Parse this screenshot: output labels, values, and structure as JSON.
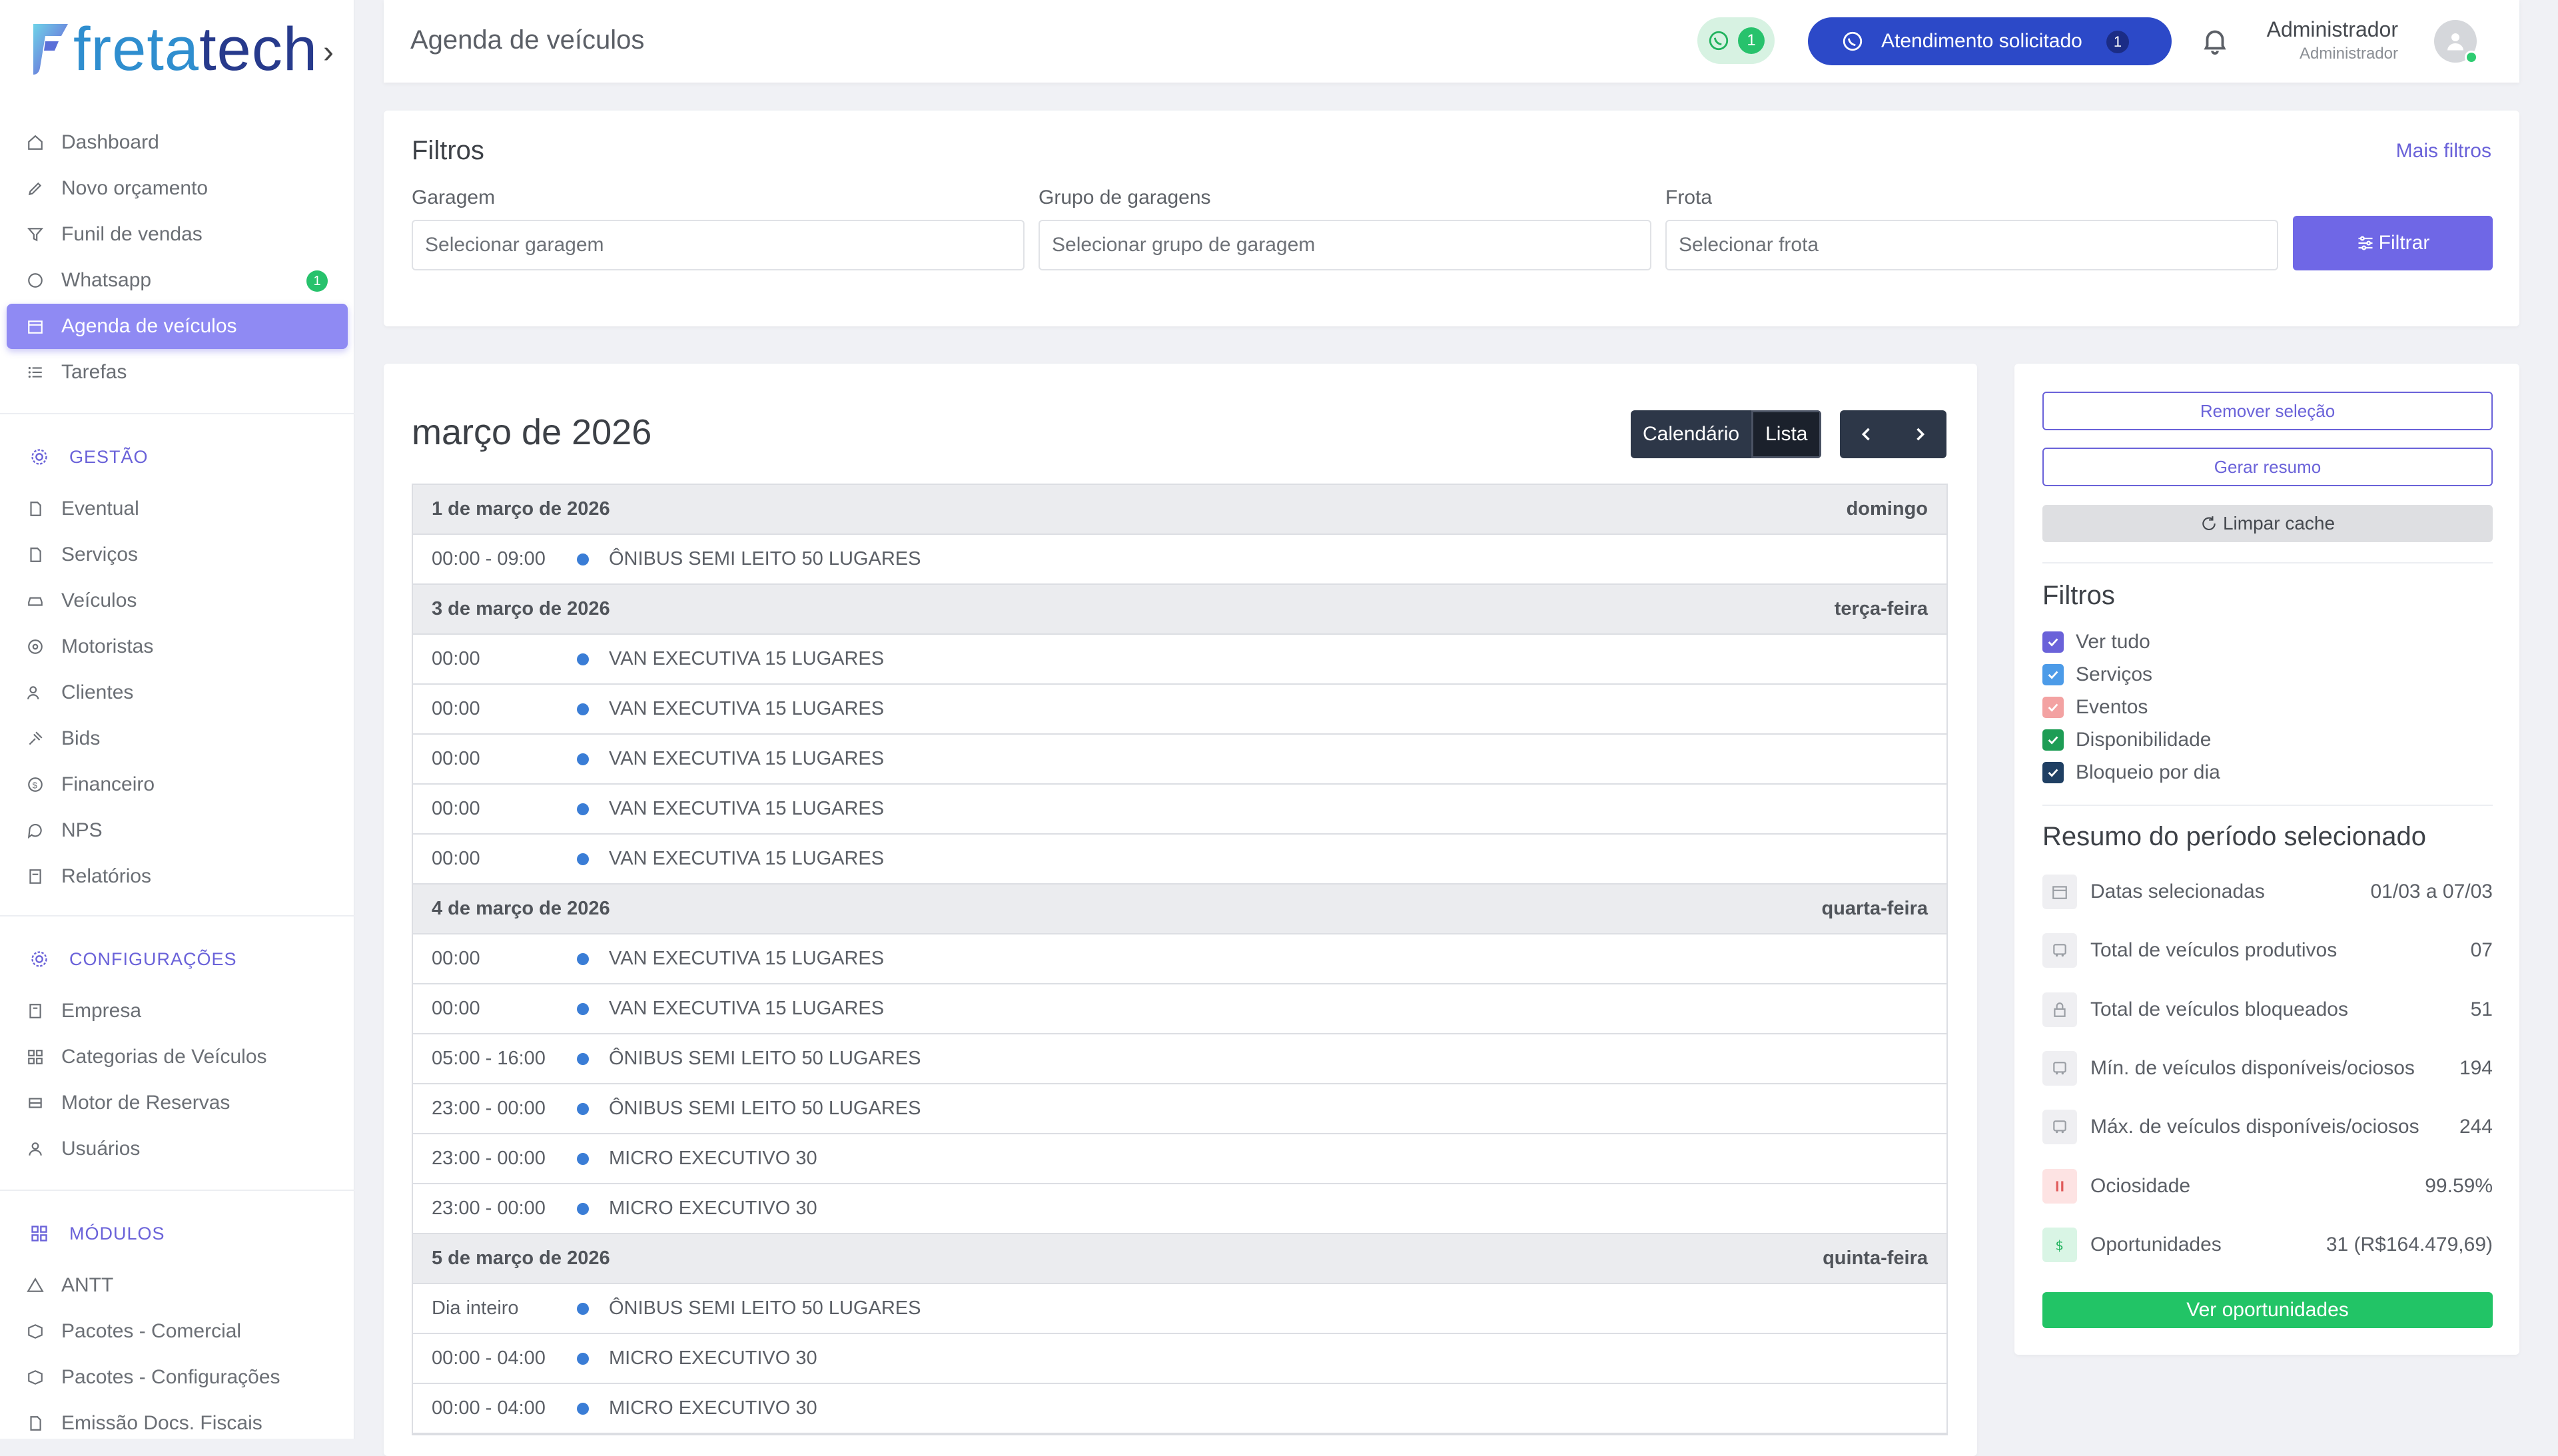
{
  "brand": {
    "fr": "freta",
    "tc": "tech"
  },
  "sidebar": {
    "main_items": [
      {
        "label": "Dashboard"
      },
      {
        "label": "Novo orçamento"
      },
      {
        "label": "Funil de vendas"
      },
      {
        "label": "Whatsapp",
        "badge": "1"
      },
      {
        "label": "Agenda de veículos",
        "active": true
      },
      {
        "label": "Tarefas"
      }
    ],
    "gestao": {
      "heading": "GESTÃO",
      "items": [
        {
          "label": "Eventual"
        },
        {
          "label": "Serviços"
        },
        {
          "label": "Veículos"
        },
        {
          "label": "Motoristas"
        },
        {
          "label": "Clientes"
        },
        {
          "label": "Bids"
        },
        {
          "label": "Financeiro"
        },
        {
          "label": "NPS"
        },
        {
          "label": "Relatórios"
        }
      ]
    },
    "config": {
      "heading": "CONFIGURAÇÕES",
      "items": [
        {
          "label": "Empresa"
        },
        {
          "label": "Categorias de Veículos"
        },
        {
          "label": "Motor de Reservas"
        },
        {
          "label": "Usuários"
        }
      ]
    },
    "modulos": {
      "heading": "MÓDULOS",
      "items": [
        {
          "label": "ANTT"
        },
        {
          "label": "Pacotes - Comercial"
        },
        {
          "label": "Pacotes - Configurações"
        },
        {
          "label": "Emissão Docs. Fiscais"
        }
      ]
    }
  },
  "header": {
    "title": "Agenda de veículos",
    "whatsapp_count": "1",
    "attend_label": "Atendimento solicitado",
    "attend_count": "1",
    "user_name": "Administrador",
    "user_role": "Administrador"
  },
  "filters": {
    "title": "Filtros",
    "more": "Mais filtros",
    "garagem_label": "Garagem",
    "garagem_placeholder": "Selecionar garagem",
    "grupo_label": "Grupo de garagens",
    "grupo_placeholder": "Selecionar grupo de garagem",
    "frota_label": "Frota",
    "frota_placeholder": "Selecionar frota",
    "button": "Filtrar"
  },
  "calendar": {
    "month": "março de 2026",
    "view_calendar": "Calendário",
    "view_list": "Lista",
    "rows": [
      {
        "type": "day",
        "date": "1 de março de 2026",
        "weekday": "domingo"
      },
      {
        "type": "ev",
        "time": "00:00 - 09:00",
        "title": "ÔNIBUS SEMI LEITO 50 LUGARES"
      },
      {
        "type": "day",
        "date": "3 de março de 2026",
        "weekday": "terça-feira"
      },
      {
        "type": "ev",
        "time": "00:00",
        "title": "VAN EXECUTIVA 15 LUGARES"
      },
      {
        "type": "ev",
        "time": "00:00",
        "title": "VAN EXECUTIVA 15 LUGARES"
      },
      {
        "type": "ev",
        "time": "00:00",
        "title": "VAN EXECUTIVA 15 LUGARES"
      },
      {
        "type": "ev",
        "time": "00:00",
        "title": "VAN EXECUTIVA 15 LUGARES"
      },
      {
        "type": "ev",
        "time": "00:00",
        "title": "VAN EXECUTIVA 15 LUGARES"
      },
      {
        "type": "day",
        "date": "4 de março de 2026",
        "weekday": "quarta-feira"
      },
      {
        "type": "ev",
        "time": "00:00",
        "title": "VAN EXECUTIVA 15 LUGARES"
      },
      {
        "type": "ev",
        "time": "00:00",
        "title": "VAN EXECUTIVA 15 LUGARES"
      },
      {
        "type": "ev",
        "time": "05:00 - 16:00",
        "title": "ÔNIBUS SEMI LEITO 50 LUGARES"
      },
      {
        "type": "ev",
        "time": "23:00 - 00:00",
        "title": "ÔNIBUS SEMI LEITO 50 LUGARES"
      },
      {
        "type": "ev",
        "time": "23:00 - 00:00",
        "title": "MICRO EXECUTIVO 30"
      },
      {
        "type": "ev",
        "time": "23:00 - 00:00",
        "title": "MICRO EXECUTIVO 30"
      },
      {
        "type": "day",
        "date": "5 de março de 2026",
        "weekday": "quinta-feira"
      },
      {
        "type": "ev",
        "time": "Dia inteiro",
        "title": "ÔNIBUS SEMI LEITO 50 LUGARES"
      },
      {
        "type": "ev",
        "time": "00:00 - 04:00",
        "title": "MICRO EXECUTIVO 30"
      },
      {
        "type": "ev",
        "time": "00:00 - 04:00",
        "title": "MICRO EXECUTIVO 30"
      }
    ]
  },
  "side": {
    "remove": "Remover seleção",
    "generate": "Gerar resumo",
    "clear_cache": "Limpar cache",
    "filters_title": "Filtros",
    "checks": [
      {
        "label": "Ver tudo",
        "color": "#6a62d9",
        "checked": true
      },
      {
        "label": "Serviços",
        "color": "#4c9be8",
        "checked": true
      },
      {
        "label": "Eventos",
        "color": "#f3a2a2",
        "checked": true
      },
      {
        "label": "Disponibilidade",
        "color": "#1e9d55",
        "checked": true
      },
      {
        "label": "Bloqueio por dia",
        "color": "#1f3f63",
        "checked": true
      }
    ],
    "summary_title": "Resumo do período selecionado",
    "summary": [
      {
        "label": "Datas selecionadas",
        "value": "01/03 a 07/03",
        "icon": "calendar-icon"
      },
      {
        "label": "Total de veículos produtivos",
        "value": "07",
        "icon": "bus-icon"
      },
      {
        "label": "Total de veículos bloqueados",
        "value": "51",
        "icon": "lock-icon"
      },
      {
        "label": "Mín. de veículos disponíveis/ociosos",
        "value": "194",
        "icon": "bus-icon"
      },
      {
        "label": "Máx. de veículos disponíveis/ociosos",
        "value": "244",
        "icon": "bus-icon"
      },
      {
        "label": "Ociosidade",
        "value": "99.59%",
        "icon": "pause-icon"
      },
      {
        "label": "Oportunidades",
        "value": "31 (R$164.479,69)",
        "icon": "dollar-icon"
      }
    ],
    "opportunities_button": "Ver oportunidades"
  },
  "colors": {
    "accent": "#6f67e6",
    "active_nav": "#8f8af3",
    "attend_button": "#2c49c8",
    "success": "#22c466",
    "event_dot": "#3a7dd6"
  }
}
